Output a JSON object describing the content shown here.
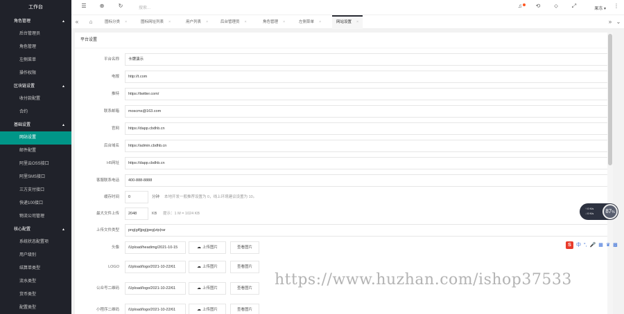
{
  "app": {
    "logo": "工作台"
  },
  "sidebar": {
    "groups": [
      {
        "title": "角色管理",
        "items": [
          "后台管理员",
          "角色管理",
          "左侧菜单",
          "操作权限"
        ]
      },
      {
        "title": "区块链设置",
        "items": [
          "收付款配置",
          "合约"
        ]
      },
      {
        "title": "基础设置",
        "items": [
          "网站设置",
          "邮件配置",
          "阿里云OSS接口",
          "阿里SMS接口",
          "三方支付接口",
          "快递100接口",
          "物流公司管理"
        ]
      },
      {
        "title": "核心配置",
        "items": [
          "系统状态配置项",
          "用户级别",
          "结算单类型",
          "流水类型",
          "货币类型",
          "配置类型"
        ]
      }
    ]
  },
  "topbar": {
    "search_placeholder": "搜索...",
    "user_name": "果冻"
  },
  "tabs": [
    "图标分类",
    "图标网址列表",
    "用户列表",
    "后台管理员",
    "角色管理",
    "左侧菜单",
    "网站设置"
  ],
  "panel": {
    "title": "平台设置"
  },
  "form": {
    "fields": [
      {
        "label": "平台名称",
        "value": "卡牌演示"
      },
      {
        "label": "电报",
        "value": "http://t.com"
      },
      {
        "label": "推特",
        "value": "https://twitter.com/"
      },
      {
        "label": "联系邮箱",
        "value": "moscms@163.com"
      },
      {
        "label": "官网",
        "value": "https://dapp.cbdhb.cn"
      },
      {
        "label": "后台域名",
        "value": "https://admin.cbdhb.cn"
      },
      {
        "label": "H5网址",
        "value": "https://dapp.cbdhb.cn"
      },
      {
        "label": "客服联系电话",
        "value": "400-888-8888"
      }
    ],
    "session": {
      "label": "缓存时间",
      "value": "0",
      "unit": "分钟",
      "tip": "本地开发一般推荐设置为 0，线上环境建议设置为 10。"
    },
    "max_upload": {
      "label": "最大文件上传",
      "value": "2048",
      "unit": "KB",
      "tip": "提示：1 M = 1024 KB"
    },
    "file_types": {
      "label": "上传文件类型",
      "value": "png|gif|jpg|jpeg|zip|rar"
    },
    "images": [
      {
        "label": "头像",
        "value": "/Upload/headimg/2021-10-15"
      },
      {
        "label": "LOGO",
        "value": "/Upload/logo/2021-10-22/61"
      },
      {
        "label": "公众号二维码",
        "value": "/Upload/logo/2021-10-22/61"
      },
      {
        "label": "小程序二维码",
        "value": "/Upload/logo/2021-10-22/61"
      }
    ],
    "upload_label": "上传图片",
    "view_label": "查看图片"
  },
  "widgets": {
    "speed": {
      "up": "↑ 0 K/s",
      "down": "↓ 0 K/s",
      "percent": "87",
      "unit": "%"
    },
    "ime": {
      "logo": "S",
      "lang": "中"
    }
  },
  "watermark": "https://www.huzhan.com/ishop37533"
}
